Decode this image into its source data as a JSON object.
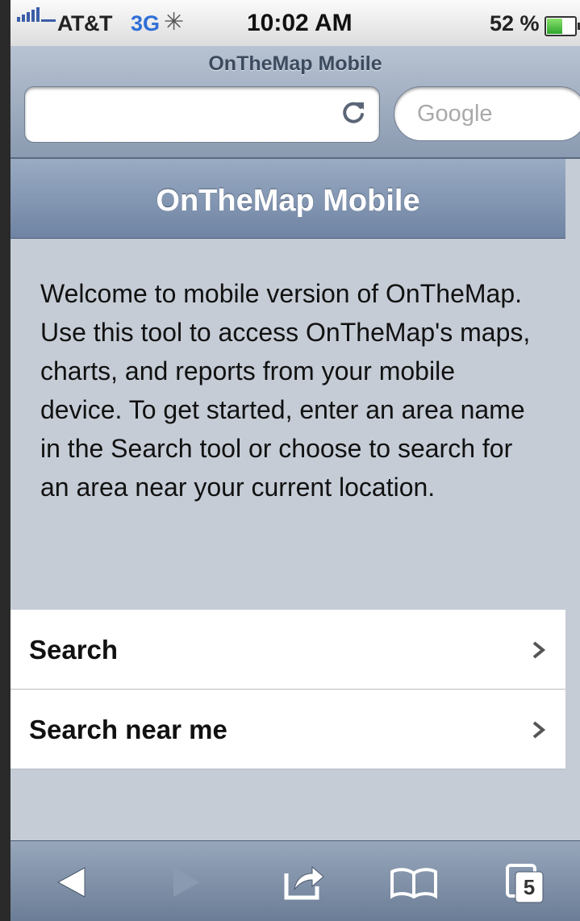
{
  "status_bar": {
    "carrier": "AT&T",
    "network": "3G",
    "time": "10:02 AM",
    "battery": "52 %"
  },
  "browser": {
    "title": "OnTheMap Mobile",
    "url_value": "",
    "search_placeholder": "Google"
  },
  "page": {
    "header": "OnTheMap Mobile",
    "intro": "Welcome to mobile version of OnTheMap. Use this tool to access OnTheMap's maps, charts, and reports from your mobile device. To get started, enter an area name in the Search tool or choose to search for an area near your current location.",
    "menu": [
      {
        "label": "Search"
      },
      {
        "label": "Search near me"
      }
    ]
  },
  "toolbar": {
    "tab_count": "5"
  },
  "colors": {
    "header_top": "#9aabc3",
    "header_bottom": "#6f84a3",
    "background": "#c5ccd6",
    "network_blue": "#2f6fd7"
  },
  "icons": [
    "signal-icon",
    "activity-icon",
    "battery-icon",
    "reload-icon",
    "chevron-right-icon",
    "back-icon",
    "forward-icon",
    "share-icon",
    "bookmarks-icon",
    "tabs-icon"
  ]
}
